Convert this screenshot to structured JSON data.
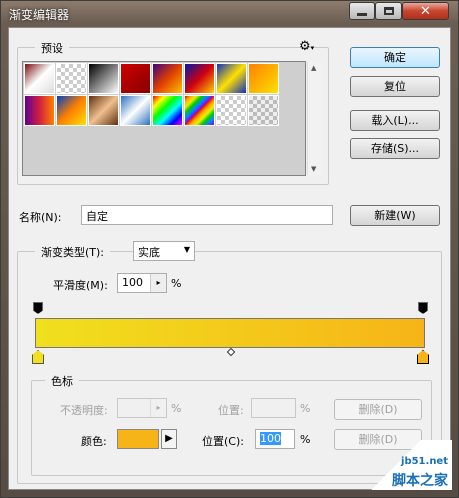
{
  "window": {
    "title": "渐变编辑器"
  },
  "presets": {
    "label": "预设"
  },
  "buttons": {
    "ok": "确定",
    "reset": "复位",
    "load": "载入(L)...",
    "save": "存储(S)...",
    "new": "新建(W)",
    "delete": "删除(D)"
  },
  "name": {
    "label": "名称(N):",
    "value": "自定"
  },
  "gradient": {
    "type_label": "渐变类型(T):",
    "type_value": "实底",
    "smooth_label": "平滑度(M):",
    "smooth_value": "100",
    "percent": "%",
    "colors": [
      "#f0e01e",
      "#f4c81a",
      "#f7b418"
    ]
  },
  "stops": {
    "label": "色标",
    "opacity_label": "不透明度:",
    "position_label": "位置:",
    "position_c_label": "位置(C):",
    "position_value": "100",
    "color_label": "颜色:",
    "color": "#f7b418"
  },
  "watermark": {
    "text": "jb51.net",
    "brand": "脚本之家"
  }
}
